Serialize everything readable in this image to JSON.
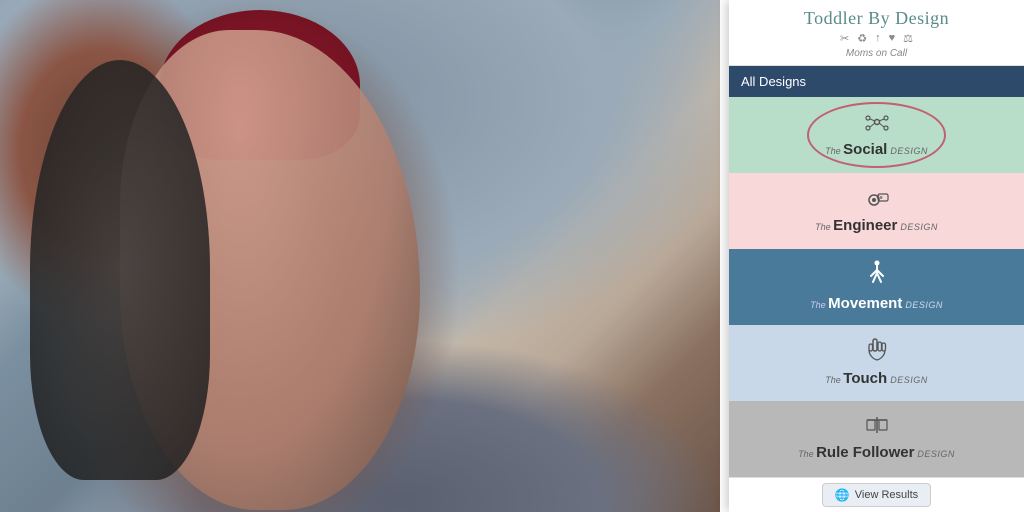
{
  "app": {
    "title": "Toddler By Design",
    "subtitle": "Moms on Call",
    "icons": [
      "✂",
      "♻",
      "↑",
      "♥",
      "⚖"
    ]
  },
  "allDesigns": {
    "label": "All Designs"
  },
  "designs": [
    {
      "id": "social",
      "the": "The",
      "main": "Social",
      "suffix": "Design",
      "bg": "#b8ddc8",
      "icon": "network",
      "selected": true
    },
    {
      "id": "engineer",
      "the": "The",
      "main": "Engineer",
      "suffix": "Design",
      "bg": "#f8d8d8",
      "icon": "gear-robot",
      "selected": false
    },
    {
      "id": "movement",
      "the": "The",
      "main": "Movement",
      "suffix": "Design",
      "bg": "#4a7a9a",
      "icon": "runner",
      "selected": false
    },
    {
      "id": "touch",
      "the": "The",
      "main": "Touch",
      "suffix": "Design",
      "bg": "#c8d8e8",
      "icon": "hand-touch",
      "selected": false
    },
    {
      "id": "rule",
      "the": "The",
      "main": "Rule Follower",
      "suffix": "Design",
      "bg": "#b8b8b8",
      "icon": "scales",
      "selected": false
    }
  ],
  "viewResults": {
    "label": "View Results"
  }
}
